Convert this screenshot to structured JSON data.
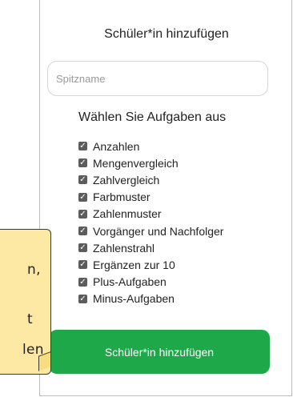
{
  "dialog": {
    "title": "Schüler*in hinzufügen",
    "nickname_placeholder": "Spitzname",
    "nickname_value": "",
    "section_title": "Wählen Sie Aufgaben aus",
    "tasks": [
      {
        "label": "Anzahlen",
        "checked": true
      },
      {
        "label": "Mengenvergleich",
        "checked": true
      },
      {
        "label": "Zahlvergleich",
        "checked": true
      },
      {
        "label": "Farbmuster",
        "checked": true
      },
      {
        "label": "Zahlenmuster",
        "checked": true
      },
      {
        "label": "Vorgänger und Nachfolger",
        "checked": true
      },
      {
        "label": "Zahlenstrahl",
        "checked": true
      },
      {
        "label": "Ergänzen zur 10",
        "checked": true
      },
      {
        "label": "Plus-Aufgaben",
        "checked": true
      },
      {
        "label": "Minus-Aufgaben",
        "checked": true
      }
    ],
    "submit_label": "Schüler*in hinzufügen",
    "accent_color": "#1fa84a"
  },
  "sticky_note": {
    "visible_fragments": [
      "n,",
      "t",
      "len"
    ],
    "color": "#fde9a3"
  }
}
